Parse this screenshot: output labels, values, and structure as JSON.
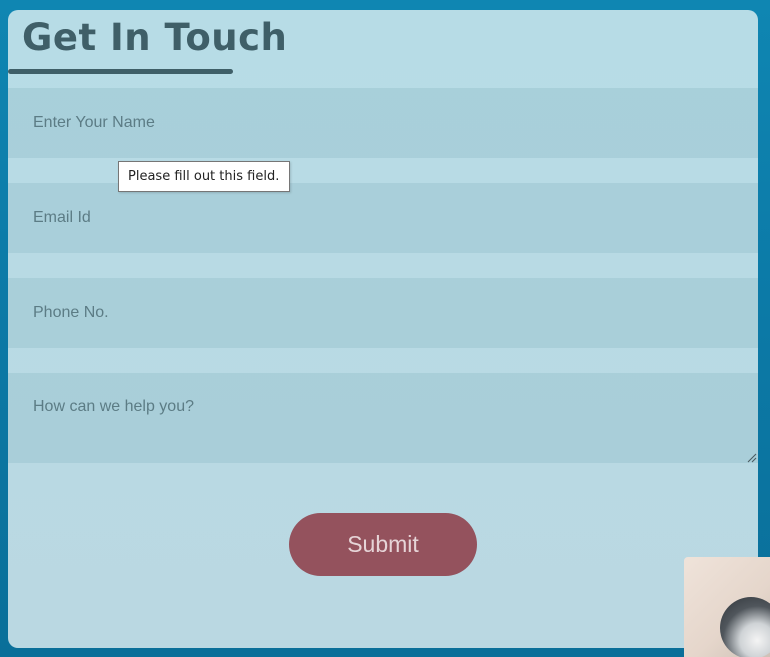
{
  "form": {
    "title": "Get In Touch",
    "fields": {
      "name_placeholder": "Enter Your Name",
      "email_placeholder": "Email Id",
      "phone_placeholder": "Phone No.",
      "message_placeholder": "How can we help you?"
    },
    "submit_label": "Submit"
  },
  "validation_tooltip": {
    "text": "Please fill out this field."
  },
  "colors": {
    "page_background": "#0c7aa7",
    "card_background": "#b7dce6",
    "title_color": "#3f5f68",
    "submit_background": "#94525d",
    "submit_text": "#e6d4d7"
  },
  "icons": {
    "resize_grip": "resize-grip-icon"
  }
}
